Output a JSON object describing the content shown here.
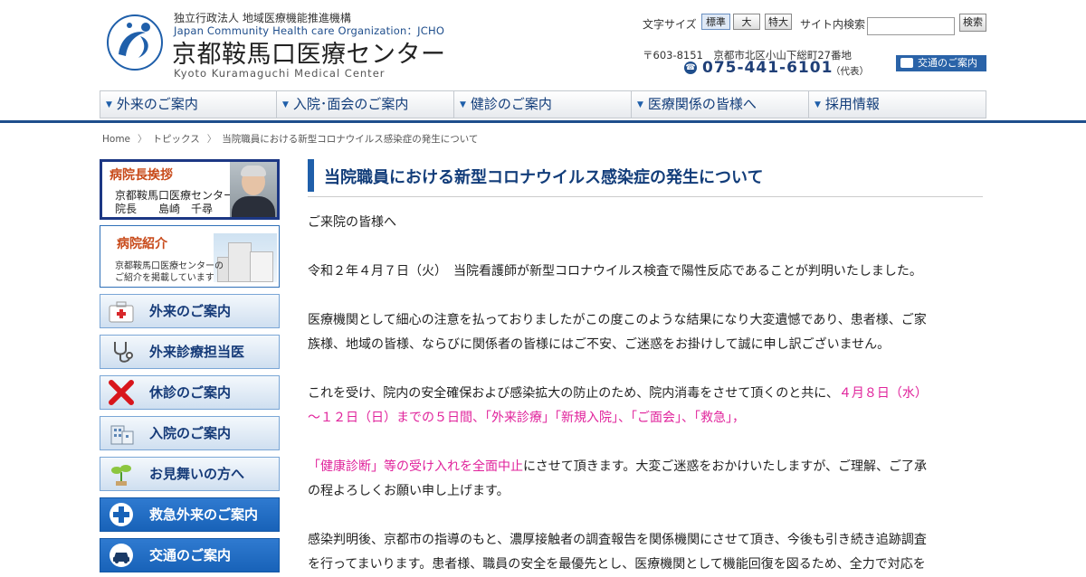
{
  "header": {
    "org_top": "独立行政法人 地域医療機能推進機構",
    "org_en": "Japan Community Health care Organization：JCHO",
    "site_title": "京都鞍馬口医療センター",
    "site_title_en": "Kyoto Kuramaguchi Medical Center",
    "logo_ring_text": "Japan Community Health care Organization",
    "font_size_label": "文字サイズ",
    "font_sizes": [
      "標準",
      "大",
      "特大"
    ],
    "search_label": "サイト内検索",
    "search_button": "検索",
    "search_placeholder": "",
    "address": "〒603-8151　京都市北区小山下総町27番地",
    "tel": "075-441-6101",
    "tel_note": "（代表）",
    "access_button": "交通のご案内"
  },
  "gnav": [
    {
      "label": "外来のご案内"
    },
    {
      "label": "入院･面会のご案内"
    },
    {
      "label": "健診のご案内"
    },
    {
      "label": "医療関係の皆様へ"
    },
    {
      "label": "採用情報"
    }
  ],
  "breadcrumb": [
    "Home",
    "トピックス",
    "当院職員における新型コロナウイルス感染症の発生について"
  ],
  "sidebar": {
    "greeting": {
      "title": "病院長挨拶",
      "org": "京都鞍馬口医療センター",
      "name": "院長　　島崎　千尋"
    },
    "intro": {
      "title": "病院紹介",
      "line1": "京都鞍馬口医療センターの",
      "line2": "ご紹介を掲載しています"
    },
    "buttons": [
      {
        "label": "外来のご案内",
        "icon": "first-aid-kit-icon"
      },
      {
        "label": "外来診療担当医",
        "icon": "stethoscope-icon"
      },
      {
        "label": "休診のご案内",
        "icon": "red-cross-mark-icon"
      },
      {
        "label": "入院のご案内",
        "icon": "hospital-building-icon"
      },
      {
        "label": "お見舞いの方へ",
        "icon": "sprout-icon"
      },
      {
        "label": "救急外来のご案内",
        "icon": "plus-cross-icon"
      },
      {
        "label": "交通のご案内",
        "icon": "car-icon"
      }
    ]
  },
  "article": {
    "title": "当院職員における新型コロナウイルス感染症の発生について",
    "greeting": "ご来院の皆様へ",
    "p1": "令和２年４月７日（火）　当院看護師が新型コロナウイルス検査で陽性反応であることが判明いたしました。",
    "p2_l1": "医療機関として細心の注意を払っておりましたがこの度このような結果になり大変遺憾であり、患者様、ご家",
    "p2_l2": "族様、地域の皆様、ならびに関係者の皆様にはご不安、ご迷惑をお掛けして誠に申し訳ございません。",
    "p3_l1_a": "これを受け、院内の安全確保および感染拡大の防止のため、院内消毒をさせて頂くのと共に、",
    "p3_l1_b": "４月８日（水）",
    "p3_l2": "～１２日（日）までの５日間、「外来診療」「新規入院」、「ご面会」、「救急」，",
    "p4_l1_a": "「健康診断」等の受け入れを全面中止",
    "p4_l1_b": "にさせて頂きます。大変ご迷惑をおかけいたしますが、ご理解、ご了承",
    "p4_l2": "の程よろしくお願い申し上げます。",
    "p5_l1": "感染判明後、京都市の指導のもと、濃厚接触者の調査報告を関係機関にさせて頂き、今後も引き続き追跡調査",
    "p5_l2": "を行ってまいります。患者様、職員の安全を最優先とし、医療機関として機能回復を図るため、全力で対応を"
  },
  "colors": {
    "brand_blue": "#1f4e8c",
    "nav_text": "#123d7a",
    "emphasis_pink": "#e0229b",
    "sidebar_title_orange": "#c84a1a"
  }
}
